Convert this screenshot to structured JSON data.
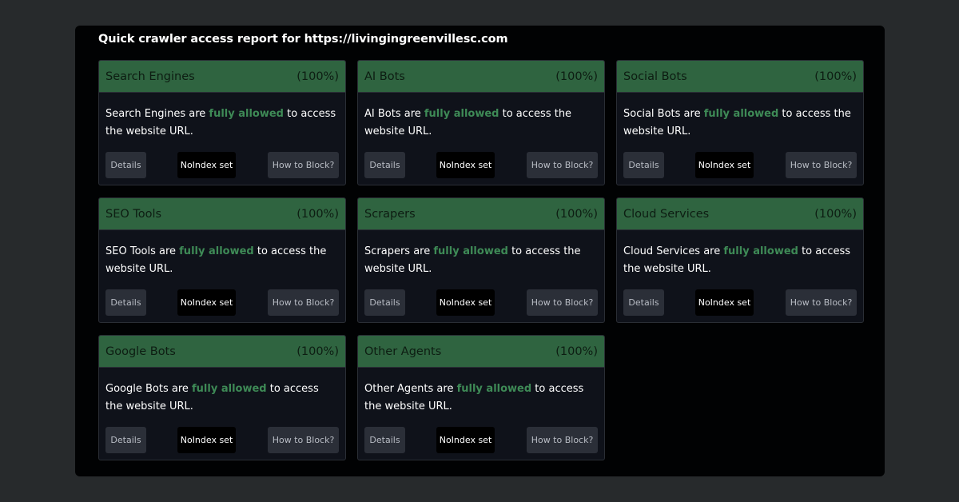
{
  "report": {
    "title": "Quick crawler access report for https://livingingreenvillesc.com"
  },
  "colors": {
    "header_green": "#2f6440",
    "highlight_green": "#3e8a56",
    "panel_bg": "#010203",
    "card_bg": "#0f121a"
  },
  "cards": [
    {
      "name": "Search Engines",
      "percent": "(100%)",
      "text_before": "Search Engines are ",
      "highlight": "fully allowed",
      "text_after": " to access the website URL.",
      "details_label": "Details",
      "noindex_label": "NoIndex set",
      "block_label": "How to Block?"
    },
    {
      "name": "AI Bots",
      "percent": "(100%)",
      "text_before": "AI Bots are ",
      "highlight": "fully allowed",
      "text_after": " to access the website URL.",
      "details_label": "Details",
      "noindex_label": "NoIndex set",
      "block_label": "How to Block?"
    },
    {
      "name": "Social Bots",
      "percent": "(100%)",
      "text_before": "Social Bots are ",
      "highlight": "fully allowed",
      "text_after": " to access the website URL.",
      "details_label": "Details",
      "noindex_label": "NoIndex set",
      "block_label": "How to Block?"
    },
    {
      "name": "SEO Tools",
      "percent": "(100%)",
      "text_before": "SEO Tools are ",
      "highlight": "fully allowed",
      "text_after": " to access the website URL.",
      "details_label": "Details",
      "noindex_label": "NoIndex set",
      "block_label": "How to Block?"
    },
    {
      "name": "Scrapers",
      "percent": "(100%)",
      "text_before": "Scrapers are ",
      "highlight": "fully allowed",
      "text_after": " to access the website URL.",
      "details_label": "Details",
      "noindex_label": "NoIndex set",
      "block_label": "How to Block?"
    },
    {
      "name": "Cloud Services",
      "percent": "(100%)",
      "text_before": "Cloud Services are ",
      "highlight": "fully allowed",
      "text_after": " to access the website URL.",
      "details_label": "Details",
      "noindex_label": "NoIndex set",
      "block_label": "How to Block?"
    },
    {
      "name": "Google Bots",
      "percent": "(100%)",
      "text_before": "Google Bots are ",
      "highlight": "fully allowed",
      "text_after": " to access the website URL.",
      "details_label": "Details",
      "noindex_label": "NoIndex set",
      "block_label": "How to Block?"
    },
    {
      "name": "Other Agents",
      "percent": "(100%)",
      "text_before": "Other Agents are ",
      "highlight": "fully allowed",
      "text_after": " to access the website URL.",
      "details_label": "Details",
      "noindex_label": "NoIndex set",
      "block_label": "How to Block?"
    }
  ]
}
